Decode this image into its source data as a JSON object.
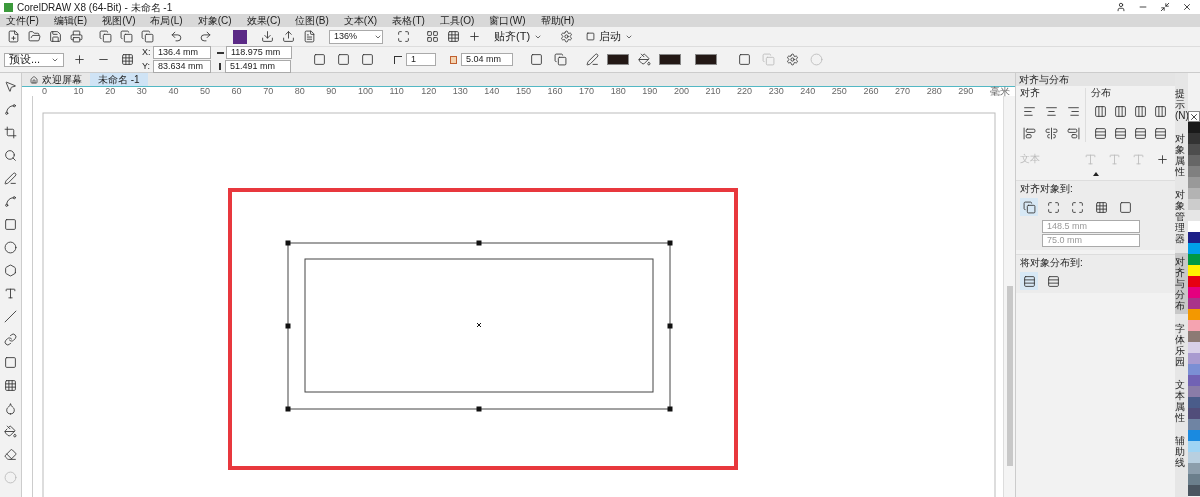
{
  "window": {
    "title": "CorelDRAW X8 (64-Bit) - 未命名 -1"
  },
  "menu": [
    "文件(F)",
    "编辑(E)",
    "视图(V)",
    "布局(L)",
    "对象(C)",
    "效果(C)",
    "位图(B)",
    "文本(X)",
    "表格(T)",
    "工具(O)",
    "窗口(W)",
    "帮助(H)"
  ],
  "toolbar": {
    "zoom": "136%",
    "snap": "贴齐(T)",
    "launch": "启动"
  },
  "property_bar": {
    "preset": "预设...",
    "x_label": "X:",
    "x": "136.4 mm",
    "y_label": "Y:",
    "y": "83.634 mm",
    "width": "118.975 mm",
    "height": "51.491 mm",
    "corners": "1",
    "outline_width": "5.04 mm"
  },
  "document_tabs": [
    {
      "label": "欢迎屏幕",
      "selected": false
    },
    {
      "label": "未命名 -1",
      "selected": true
    }
  ],
  "ruler": {
    "ticks": [
      "0",
      "10",
      "20",
      "30",
      "40",
      "50",
      "60",
      "70",
      "80",
      "90",
      "100",
      "110",
      "120",
      "130",
      "140",
      "150",
      "160",
      "170",
      "180",
      "190",
      "200",
      "210",
      "220",
      "230",
      "240",
      "250",
      "260",
      "270",
      "280",
      "290"
    ],
    "unit": "毫米"
  },
  "docker": {
    "title": "对齐与分布",
    "align_heading": "对齐",
    "distribute_heading": "分布",
    "text_label": "文本",
    "align_to_heading": "对齐对象到:",
    "x_value": "148.5 mm",
    "y_value": "75.0 mm",
    "distribute_to_heading": "将对象分布到:"
  },
  "docker_tabs": [
    {
      "label": "提示(N)",
      "selected": false
    },
    {
      "label": "对象属性",
      "selected": false
    },
    {
      "label": "对象管理器",
      "selected": false
    },
    {
      "label": "对齐与分布",
      "selected": true
    },
    {
      "label": "字体乐园",
      "selected": false
    },
    {
      "label": "文本属性",
      "selected": false
    },
    {
      "label": "辅助线",
      "selected": false
    }
  ],
  "palette": [
    {
      "color": "#1a1a1a"
    },
    {
      "color": "#333333"
    },
    {
      "color": "#4d4d4d"
    },
    {
      "color": "#666666"
    },
    {
      "color": "#808080"
    },
    {
      "color": "#999999"
    },
    {
      "color": "#b3b3b3"
    },
    {
      "color": "#cccccc"
    },
    {
      "color": "#e6e6e6"
    },
    {
      "color": "#ffffff"
    },
    {
      "color": "#1d2088"
    },
    {
      "color": "#00a0e9"
    },
    {
      "color": "#009944"
    },
    {
      "color": "#fff100"
    },
    {
      "color": "#e60012"
    },
    {
      "color": "#e4007f"
    },
    {
      "color": "#a9348a"
    },
    {
      "color": "#f39800"
    },
    {
      "color": "#f5a3b0"
    },
    {
      "color": "#8c7a74"
    },
    {
      "color": "#d8d0e8"
    },
    {
      "color": "#a99bd0"
    },
    {
      "color": "#7b8fd4"
    },
    {
      "color": "#7162b4"
    },
    {
      "color": "#8a7ca8"
    },
    {
      "color": "#4a5c8a"
    },
    {
      "color": "#514d7a"
    },
    {
      "color": "#6f84a3"
    },
    {
      "color": "#1a8ae0"
    },
    {
      "color": "#9fd4f4"
    },
    {
      "color": "#b8cfe0"
    },
    {
      "color": "#8c9eac"
    },
    {
      "color": "#6b7f8c"
    },
    {
      "color": "#4a5560"
    }
  ]
}
